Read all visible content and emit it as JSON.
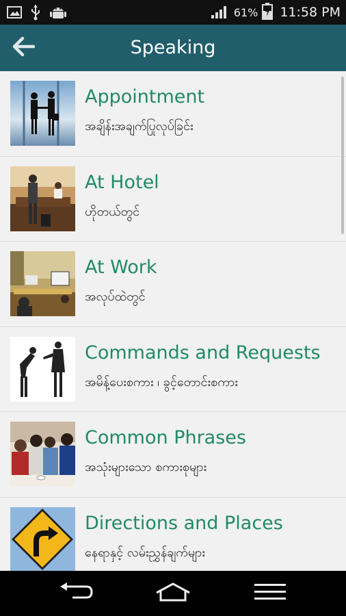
{
  "status_bar": {
    "battery_percent": "61%",
    "time": "11:58 PM",
    "icons": [
      "image-icon",
      "usb-icon",
      "android-icon",
      "signal-icon",
      "battery-charging-icon"
    ]
  },
  "app_bar": {
    "title": "Speaking",
    "back_icon": "arrow-back-icon"
  },
  "topics": [
    {
      "title": "Appointment",
      "subtitle": "အချိန်းအချက်ပြုလုပ်ခြင်း",
      "image": "handshake-silhouette"
    },
    {
      "title": "At Hotel",
      "subtitle": "ဟိုတယ်တွင်",
      "image": "hotel-reception"
    },
    {
      "title": "At Work",
      "subtitle": "အလုပ်ထဲတွင်",
      "image": "office"
    },
    {
      "title": "Commands and Requests",
      "subtitle": "အမိန့်ပေးစကား ၊ ခွင့်တောင်းစကား",
      "image": "two-people-bowing"
    },
    {
      "title": "Common Phrases",
      "subtitle": "အသုံးများသော စကားစုများ",
      "image": "friends-at-cafe"
    },
    {
      "title": "Directions and Places",
      "subtitle": "နေရာနှင့် လမ်းညွှန်ချက်များ",
      "image": "turn-road-sign"
    }
  ],
  "nav_bar": {
    "icons": [
      "back-nav-icon",
      "home-nav-icon",
      "menu-nav-icon"
    ]
  }
}
